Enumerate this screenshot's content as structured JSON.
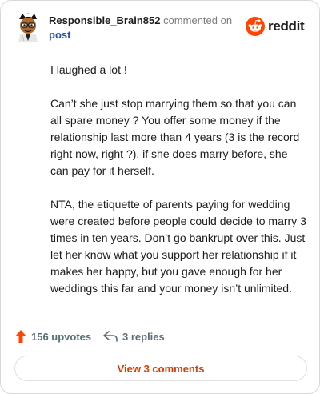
{
  "comment": {
    "username": "Responsible_Brain852",
    "commented_on": "commented on",
    "post_label": "post",
    "paragraphs": [
      "I laughed a lot !",
      "Can’t she just stop marrying them so that you can all spare money ? You offer some money if the relationship last more than 4 years (3 is the record right now, right ?), if she does marry before, she can pay for it herself.",
      "NTA, the etiquette of parents paying for wedding were created before people could decide to marry 3 times in ten years. Don’t go bankrupt over this. Just let her know what you support her relationship if it makes her happy, but you gave enough for her weddings this far and your money isn’t unlimited."
    ]
  },
  "brand": {
    "name": "reddit",
    "color": "#ff4500"
  },
  "actions": {
    "upvotes": "156 upvotes",
    "replies": "3 replies",
    "upvote_color": "#ff4500"
  },
  "footer": {
    "view_comments": "View 3 comments",
    "accent": "#d93a00"
  },
  "icons": [
    "avatar",
    "reddit-logo-icon",
    "upvote-arrow-icon",
    "reply-icon"
  ]
}
